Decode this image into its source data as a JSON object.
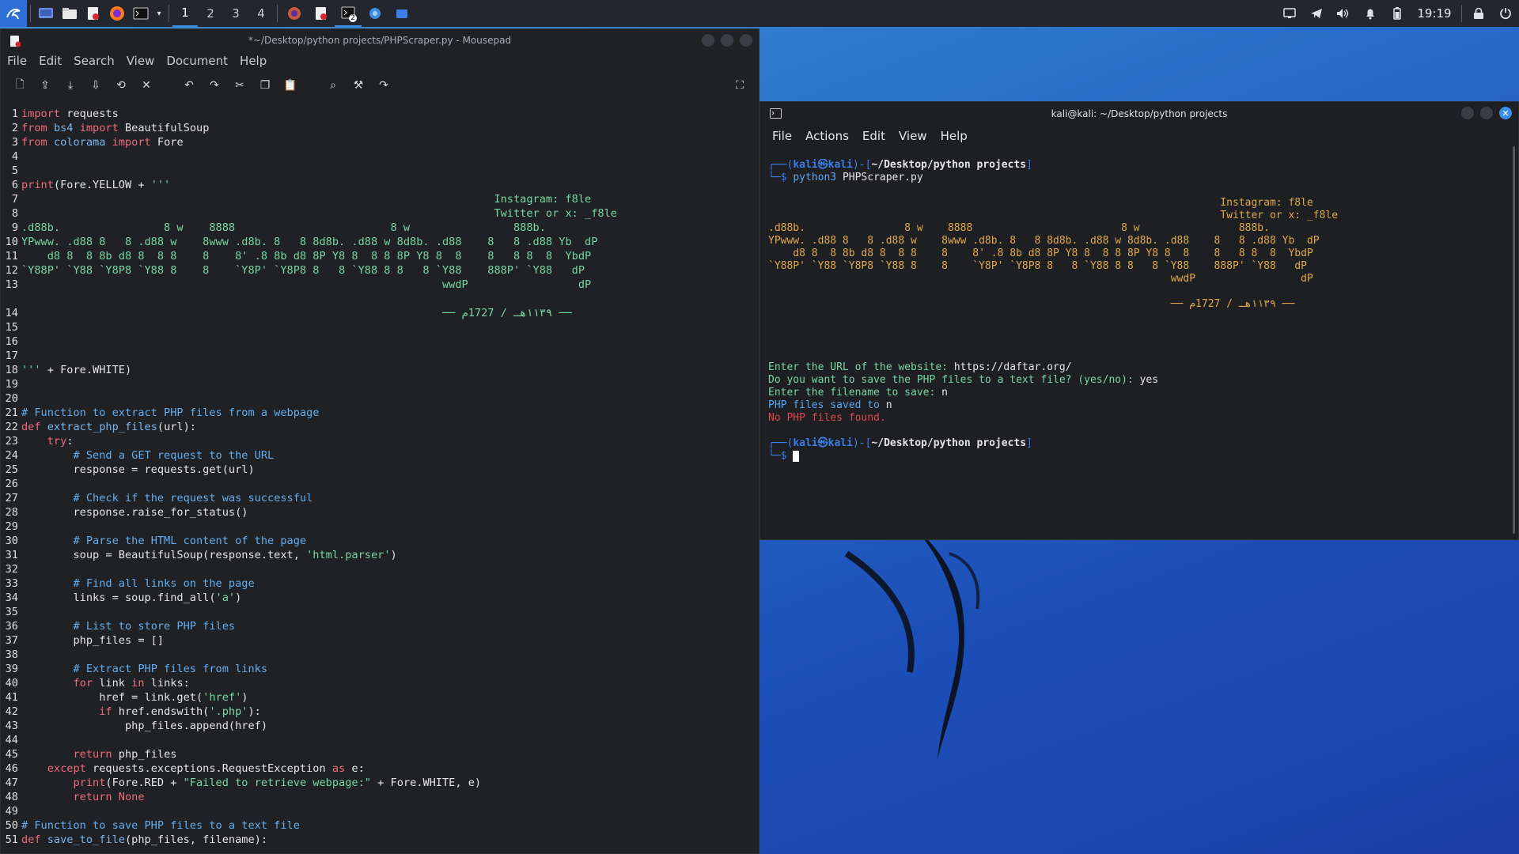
{
  "taskbar": {
    "workspaces": [
      "1",
      "2",
      "3",
      "4"
    ],
    "active_workspace": "1",
    "clock": "19:19",
    "terminal_badge": "2"
  },
  "mousepad": {
    "title": "*~/Desktop/python projects/PHPScraper.py - Mousepad",
    "menu": [
      "File",
      "Edit",
      "Search",
      "View",
      "Document",
      "Help"
    ],
    "lines": [
      {
        "n": "1",
        "segs": [
          [
            "kw",
            "import"
          ],
          [
            "",
            " requests"
          ]
        ]
      },
      {
        "n": "2",
        "segs": [
          [
            "kw",
            "from"
          ],
          [
            "",
            " "
          ],
          [
            "mod",
            "bs4"
          ],
          [
            "",
            " "
          ],
          [
            "kw",
            "import"
          ],
          [
            "",
            " BeautifulSoup"
          ]
        ]
      },
      {
        "n": "3",
        "segs": [
          [
            "kw",
            "from"
          ],
          [
            "",
            " "
          ],
          [
            "mod",
            "colorama"
          ],
          [
            "",
            " "
          ],
          [
            "kw",
            "import"
          ],
          [
            "",
            " Fore"
          ]
        ]
      },
      {
        "n": "4",
        "segs": []
      },
      {
        "n": "5",
        "segs": []
      },
      {
        "n": "6",
        "segs": [
          [
            "kw",
            "print"
          ],
          [
            "",
            "(Fore.YELLOW + "
          ],
          [
            "str",
            "'''"
          ]
        ]
      },
      {
        "n": "7",
        "segs": [
          [
            "art",
            "                                                                         Instagram: f8le"
          ]
        ]
      },
      {
        "n": "8",
        "segs": [
          [
            "art",
            "                                                                         Twitter or x: _f8le"
          ]
        ]
      },
      {
        "n": "9",
        "segs": [
          [
            "art",
            ".d88b.                8 w    8888                        8 w                888b."
          ]
        ]
      },
      {
        "n": "10",
        "segs": [
          [
            "art",
            "YPwww. .d88 8   8 .d88 w    8www .d8b. 8   8 8d8b. .d88 w 8d8b. .d88    8   8 .d88 Yb  dP"
          ]
        ]
      },
      {
        "n": "11",
        "segs": [
          [
            "art",
            "    d8 8  8 8b d8 8  8 8    8    8' .8 8b d8 8P Y8 8  8 8 8P Y8 8  8    8   8 8  8  YbdP"
          ]
        ]
      },
      {
        "n": "12",
        "segs": [
          [
            "art",
            "`Y88P' `Y88 `Y8P8 `Y88 8    8    `Y8P' `Y8P8 8   8 `Y88 8 8   8 `Y88    888P' `Y88   dP"
          ]
        ]
      },
      {
        "n": "13",
        "segs": [
          [
            "art",
            "                                                                 wwdP                 dP"
          ]
        ]
      },
      {
        "n": "14",
        "tall": true,
        "segs": [
          [
            "art",
            "\n                                                                 ── ١١٣٩هـ / 1727م ──"
          ]
        ]
      },
      {
        "n": "15",
        "segs": []
      },
      {
        "n": "16",
        "segs": []
      },
      {
        "n": "17",
        "segs": []
      },
      {
        "n": "18",
        "segs": [
          [
            "str",
            "'''"
          ],
          [
            "",
            " + Fore.WHITE)"
          ]
        ]
      },
      {
        "n": "19",
        "segs": []
      },
      {
        "n": "20",
        "segs": []
      },
      {
        "n": "21",
        "segs": [
          [
            "cm",
            "# Function to extract PHP files from a webpage"
          ]
        ]
      },
      {
        "n": "22",
        "segs": [
          [
            "kw",
            "def"
          ],
          [
            "",
            " "
          ],
          [
            "fn",
            "extract_php_files"
          ],
          [
            "",
            "(url):"
          ]
        ]
      },
      {
        "n": "23",
        "segs": [
          [
            "",
            "    "
          ],
          [
            "kw",
            "try"
          ],
          [
            "",
            ":"
          ]
        ]
      },
      {
        "n": "24",
        "segs": [
          [
            "",
            "        "
          ],
          [
            "cm",
            "# Send a GET request to the URL"
          ]
        ]
      },
      {
        "n": "25",
        "segs": [
          [
            "",
            "        response = requests.get(url)"
          ]
        ]
      },
      {
        "n": "26",
        "segs": []
      },
      {
        "n": "27",
        "segs": [
          [
            "",
            "        "
          ],
          [
            "cm",
            "# Check if the request was successful"
          ]
        ]
      },
      {
        "n": "28",
        "segs": [
          [
            "",
            "        response.raise_for_status()"
          ]
        ]
      },
      {
        "n": "29",
        "segs": []
      },
      {
        "n": "30",
        "segs": [
          [
            "",
            "        "
          ],
          [
            "cm",
            "# Parse the HTML content of the page"
          ]
        ]
      },
      {
        "n": "31",
        "segs": [
          [
            "",
            "        soup = BeautifulSoup(response.text, "
          ],
          [
            "str",
            "'html.parser'"
          ],
          [
            "",
            ")"
          ]
        ]
      },
      {
        "n": "32",
        "segs": []
      },
      {
        "n": "33",
        "segs": [
          [
            "",
            "        "
          ],
          [
            "cm",
            "# Find all links on the page"
          ]
        ]
      },
      {
        "n": "34",
        "segs": [
          [
            "",
            "        links = soup.find_all("
          ],
          [
            "str",
            "'a'"
          ],
          [
            "",
            ")"
          ]
        ]
      },
      {
        "n": "35",
        "segs": []
      },
      {
        "n": "36",
        "segs": [
          [
            "",
            "        "
          ],
          [
            "cm",
            "# List to store PHP files"
          ]
        ]
      },
      {
        "n": "37",
        "segs": [
          [
            "",
            "        php_files = []"
          ]
        ]
      },
      {
        "n": "38",
        "segs": []
      },
      {
        "n": "39",
        "segs": [
          [
            "",
            "        "
          ],
          [
            "cm",
            "# Extract PHP files from links"
          ]
        ]
      },
      {
        "n": "40",
        "segs": [
          [
            "",
            "        "
          ],
          [
            "kw",
            "for"
          ],
          [
            "",
            " link "
          ],
          [
            "kw",
            "in"
          ],
          [
            "",
            " links:"
          ]
        ]
      },
      {
        "n": "41",
        "segs": [
          [
            "",
            "            href = link.get("
          ],
          [
            "str",
            "'href'"
          ],
          [
            "",
            ")"
          ]
        ]
      },
      {
        "n": "42",
        "segs": [
          [
            "",
            "            "
          ],
          [
            "kw",
            "if"
          ],
          [
            "",
            " href.endswith("
          ],
          [
            "str",
            "'.php'"
          ],
          [
            "",
            "):"
          ]
        ]
      },
      {
        "n": "43",
        "segs": [
          [
            "",
            "                php_files.append(href)"
          ]
        ]
      },
      {
        "n": "44",
        "segs": []
      },
      {
        "n": "45",
        "segs": [
          [
            "",
            "        "
          ],
          [
            "kw",
            "return"
          ],
          [
            "",
            " php_files"
          ]
        ]
      },
      {
        "n": "46",
        "segs": [
          [
            "",
            "    "
          ],
          [
            "kw",
            "except"
          ],
          [
            "",
            " requests.exceptions.RequestException "
          ],
          [
            "kw",
            "as"
          ],
          [
            "",
            " e:"
          ]
        ]
      },
      {
        "n": "47",
        "segs": [
          [
            "",
            "        "
          ],
          [
            "kw",
            "print"
          ],
          [
            "",
            "(Fore.RED + "
          ],
          [
            "str",
            "\"Failed to retrieve webpage:\""
          ],
          [
            "",
            " + Fore.WHITE, e)"
          ]
        ]
      },
      {
        "n": "48",
        "segs": [
          [
            "",
            "        "
          ],
          [
            "kw",
            "return"
          ],
          [
            "",
            " "
          ],
          [
            "kw",
            "None"
          ]
        ]
      },
      {
        "n": "49",
        "segs": []
      },
      {
        "n": "50",
        "segs": [
          [
            "cm",
            "# Function to save PHP files to a text file"
          ]
        ]
      },
      {
        "n": "51",
        "segs": [
          [
            "kw",
            "def"
          ],
          [
            "",
            " "
          ],
          [
            "fn",
            "save_to_file"
          ],
          [
            "",
            "(php_files, filename):"
          ]
        ]
      }
    ]
  },
  "terminal": {
    "title": "kali@kali: ~/Desktop/python projects",
    "menu": [
      "File",
      "Actions",
      "Edit",
      "View",
      "Help"
    ],
    "lines": [
      [
        [
          "p-frame",
          "┌──("
        ],
        [
          "p-user",
          "kali㉿kali"
        ],
        [
          "p-frame",
          ")-["
        ],
        [
          "p-path",
          "~/Desktop/python projects"
        ],
        [
          "p-frame",
          "]"
        ]
      ],
      [
        [
          "p-frame",
          "└─$ "
        ],
        [
          "t-blue",
          "python3 "
        ],
        [
          "t-ans",
          "PHPScraper.py"
        ]
      ],
      [],
      [
        [
          "t-art",
          "                                                                         Instagram: f8le"
        ]
      ],
      [
        [
          "t-art",
          "                                                                         Twitter or x: _f8le"
        ]
      ],
      [
        [
          "t-art",
          ".d88b.                8 w    8888                        8 w                888b."
        ]
      ],
      [
        [
          "t-art",
          "YPwww. .d88 8   8 .d88 w    8www .d8b. 8   8 8d8b. .d88 w 8d8b. .d88    8   8 .d88 Yb  dP"
        ]
      ],
      [
        [
          "t-art",
          "    d8 8  8 8b d8 8  8 8    8    8' .8 8b d8 8P Y8 8  8 8 8P Y8 8  8    8   8 8  8  YbdP"
        ]
      ],
      [
        [
          "t-art",
          "`Y88P' `Y88 `Y8P8 `Y88 8    8    `Y8P' `Y8P8 8   8 `Y88 8 8   8 `Y88    888P' `Y88   dP"
        ]
      ],
      [
        [
          "t-art",
          "                                                                 wwdP                 dP"
        ]
      ],
      [],
      [
        [
          "t-art",
          "                                                                 ── ١١٣٩هـ / 1727م ──"
        ]
      ],
      [],
      [],
      [],
      [],
      [
        [
          "t-q",
          "Enter the URL of the website: "
        ],
        [
          "t-ans",
          "https://daftar.org/"
        ]
      ],
      [
        [
          "t-q",
          "Do you want to save the PHP files to a text file? (yes/no): "
        ],
        [
          "t-ans",
          "yes"
        ]
      ],
      [
        [
          "t-q",
          "Enter the filename to save: "
        ],
        [
          "t-ans",
          "n"
        ]
      ],
      [
        [
          "t-blue",
          "PHP files saved to "
        ],
        [
          "t-ans",
          "n"
        ]
      ],
      [
        [
          "t-red",
          "No PHP files found."
        ]
      ],
      [],
      [
        [
          "p-frame",
          "┌──("
        ],
        [
          "p-user",
          "kali㉿kali"
        ],
        [
          "p-frame",
          ")-["
        ],
        [
          "p-path",
          "~/Desktop/python projects"
        ],
        [
          "p-frame",
          "]"
        ]
      ],
      [
        [
          "p-frame",
          "└─$ "
        ],
        [
          "cursor",
          ""
        ]
      ]
    ]
  }
}
